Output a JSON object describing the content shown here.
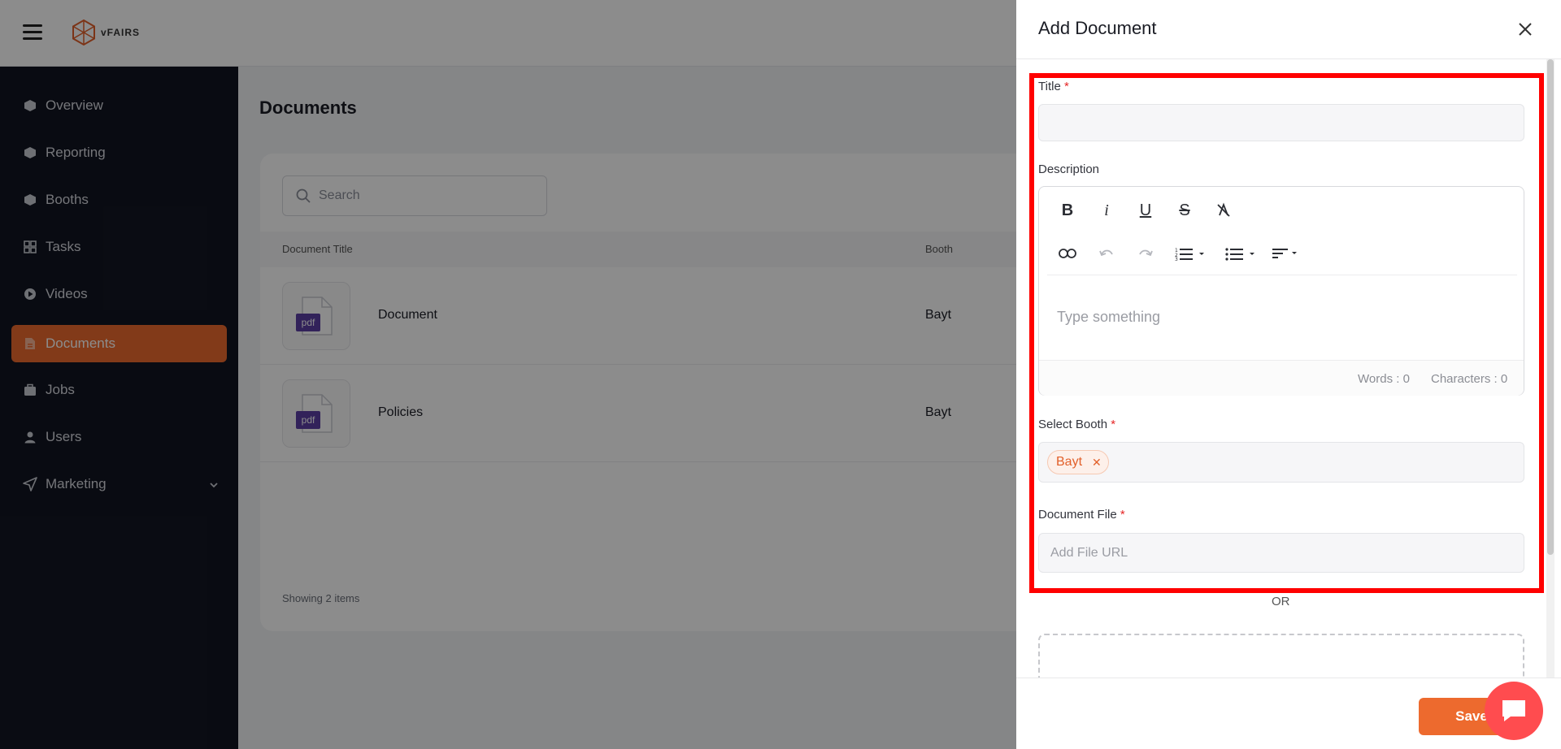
{
  "brand": {
    "name": "vFAIRS",
    "accent": "#ed6a2e"
  },
  "sidebar": {
    "items": [
      {
        "label": "Overview",
        "icon": "cube-icon"
      },
      {
        "label": "Reporting",
        "icon": "cube-icon"
      },
      {
        "label": "Booths",
        "icon": "cube-icon"
      },
      {
        "label": "Tasks",
        "icon": "grid-icon"
      },
      {
        "label": "Videos",
        "icon": "play-icon"
      },
      {
        "label": "Documents",
        "icon": "document-icon",
        "active": true
      },
      {
        "label": "Jobs",
        "icon": "briefcase-icon"
      },
      {
        "label": "Users",
        "icon": "user-icon"
      },
      {
        "label": "Marketing",
        "icon": "send-icon"
      }
    ]
  },
  "page": {
    "title": "Documents",
    "search_placeholder": "Search",
    "columns": [
      "Document Title",
      "Booth"
    ],
    "rows": [
      {
        "title": "Document",
        "booth": "Bayt",
        "file_type": "pdf"
      },
      {
        "title": "Policies",
        "booth": "Bayt",
        "file_type": "pdf"
      }
    ],
    "showing": "Showing 2 items"
  },
  "drawer": {
    "title": "Add Document",
    "title_label": "Title",
    "required_mark": "*",
    "description_label": "Description",
    "editor_placeholder": "Type something",
    "words": "Words : 0",
    "characters": "Characters : 0",
    "booth_label": "Select Booth",
    "booth_chip": "Bayt",
    "file_label": "Document File",
    "file_placeholder": "Add File URL",
    "or_text": "OR",
    "save_label": "Save"
  }
}
